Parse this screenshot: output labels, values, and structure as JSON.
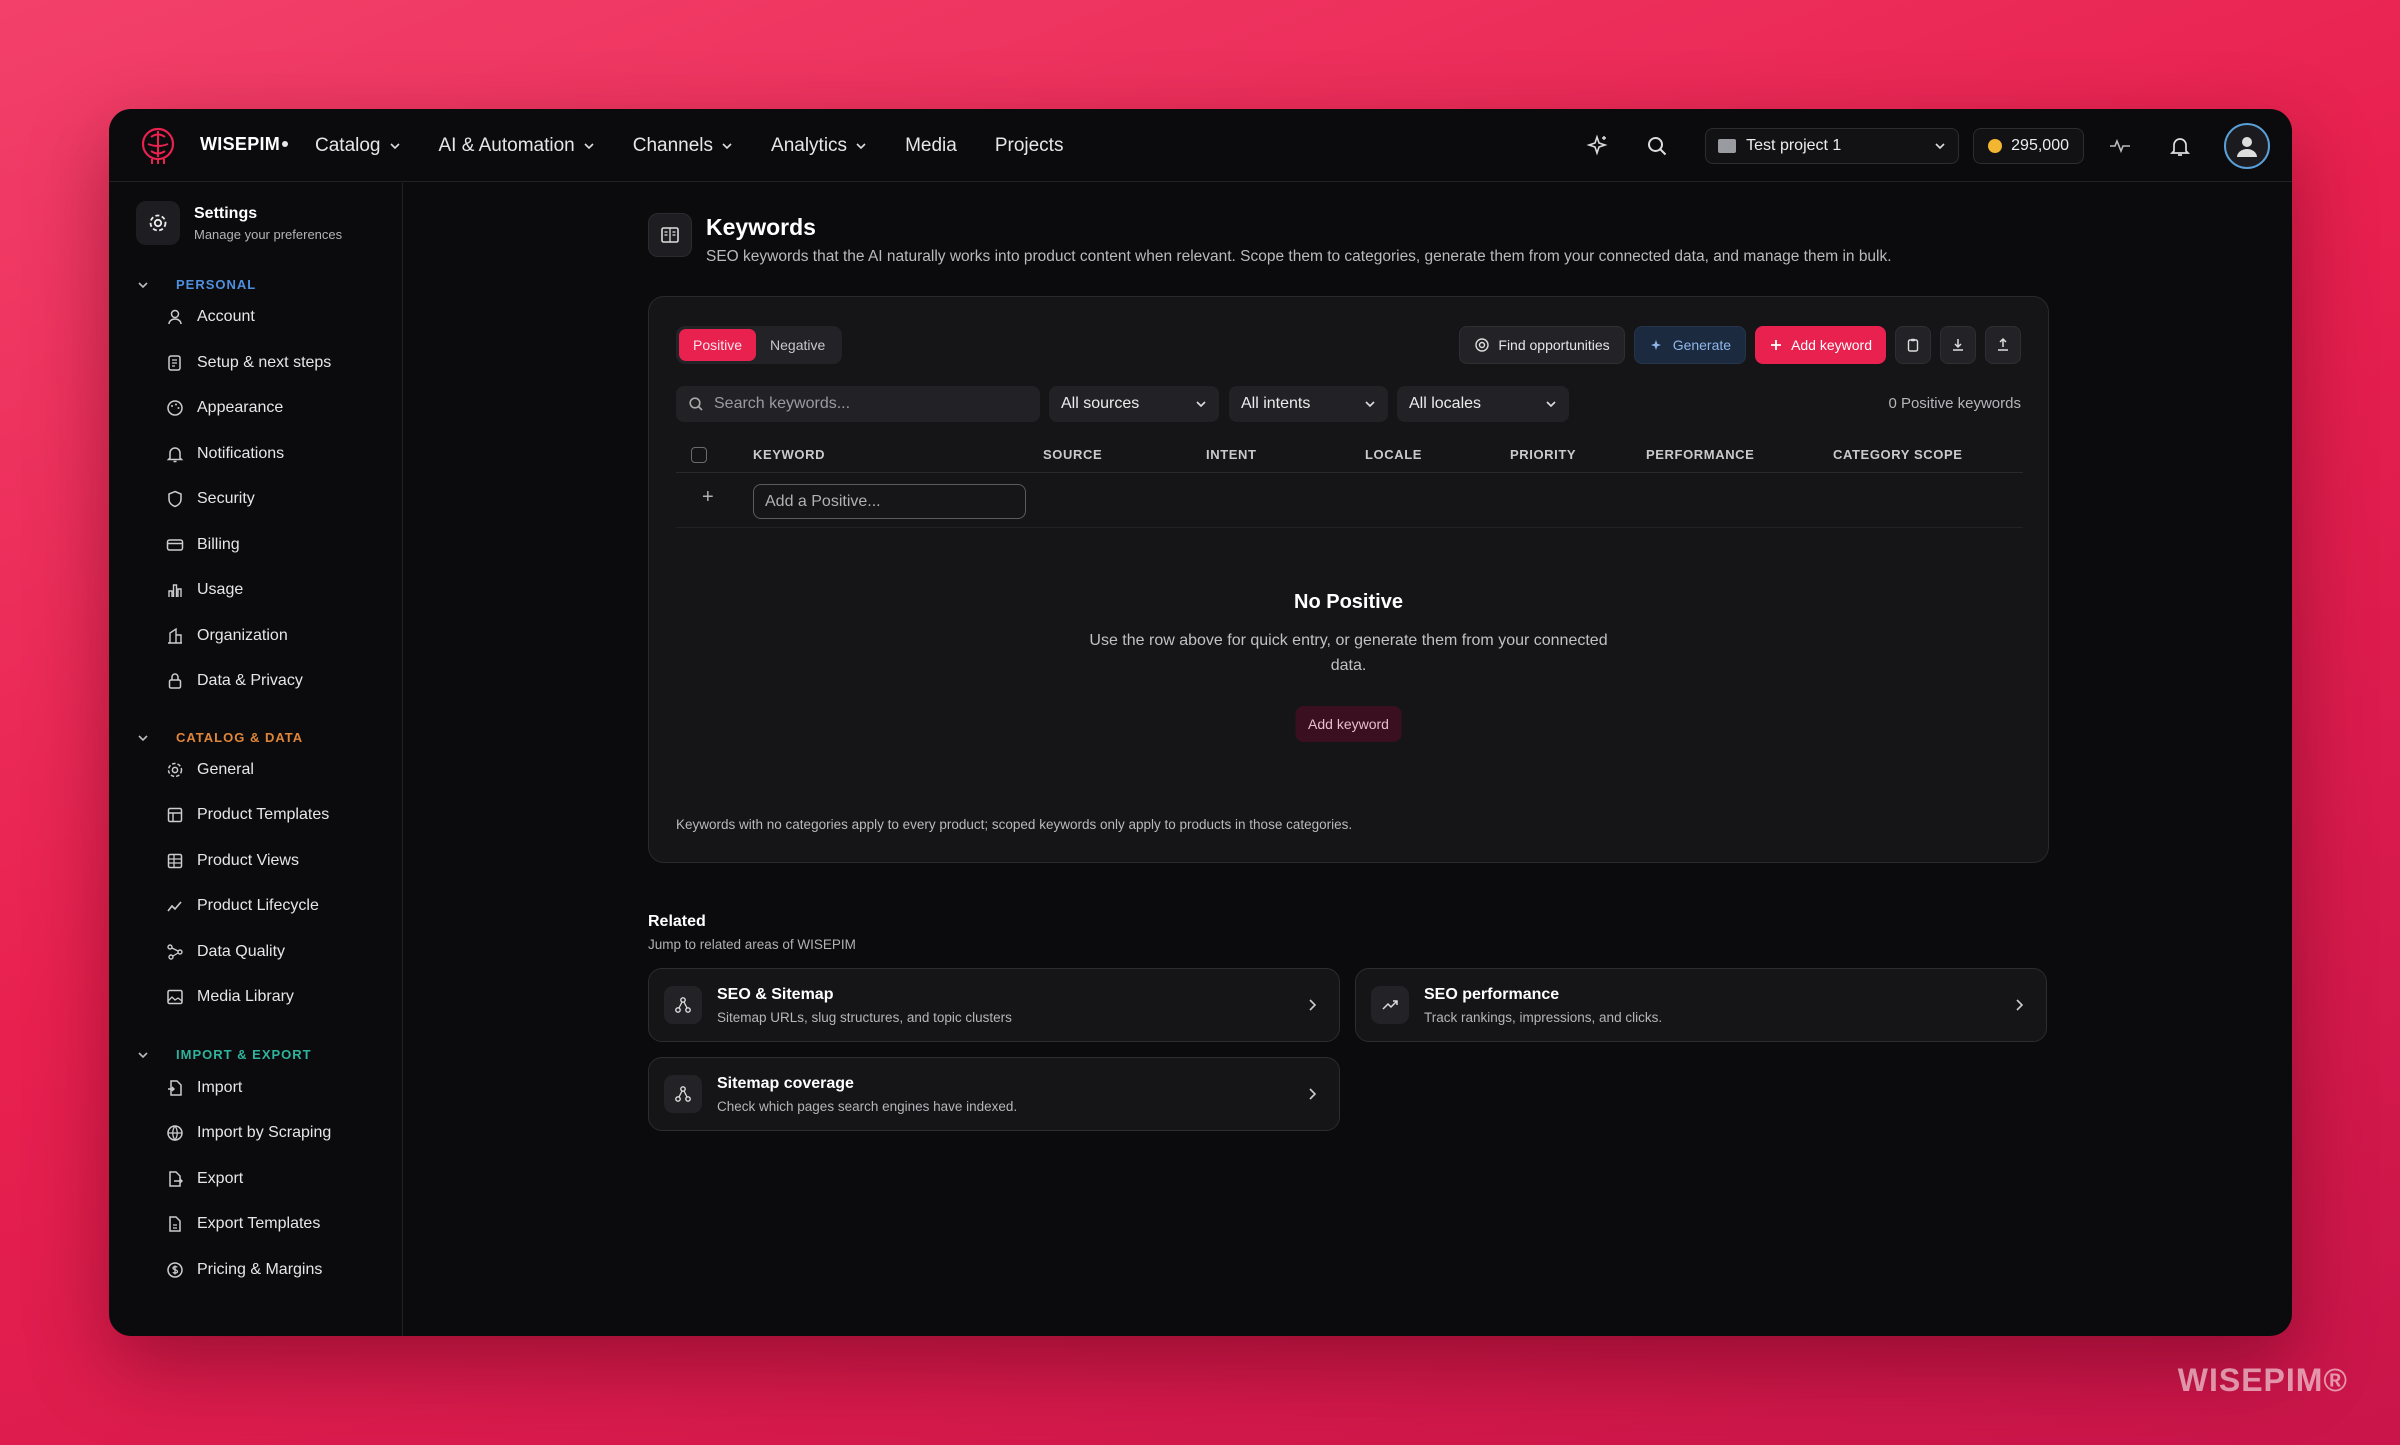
{
  "brand": {
    "name": "WISEPIM"
  },
  "nav": {
    "items": [
      {
        "label": "Catalog",
        "dropdown": true
      },
      {
        "label": "AI & Automation",
        "dropdown": true
      },
      {
        "label": "Channels",
        "dropdown": true
      },
      {
        "label": "Analytics",
        "dropdown": true
      },
      {
        "label": "Media",
        "dropdown": false
      },
      {
        "label": "Projects",
        "dropdown": false
      }
    ]
  },
  "topbar": {
    "project": "Test project 1",
    "credits": "295,000"
  },
  "sidebar": {
    "title": "Settings",
    "subtitle": "Manage your preferences",
    "sections": [
      {
        "label": "PERSONAL",
        "color": "#4f8fe0",
        "items": [
          "Account",
          "Setup & next steps",
          "Appearance",
          "Notifications",
          "Security",
          "Billing",
          "Usage",
          "Organization",
          "Data & Privacy"
        ]
      },
      {
        "label": "CATALOG & DATA",
        "color": "#e0863a",
        "items": [
          "General",
          "Product Templates",
          "Product Views",
          "Product Lifecycle",
          "Data Quality",
          "Media Library"
        ]
      },
      {
        "label": "IMPORT & EXPORT",
        "color": "#2fb39c",
        "items": [
          "Import",
          "Import by Scraping",
          "Export",
          "Export Templates",
          "Pricing & Margins"
        ]
      }
    ]
  },
  "page": {
    "title": "Keywords",
    "description": "SEO keywords that the AI naturally works into product content when relevant. Scope them to categories, generate them from your connected data, and manage them in bulk."
  },
  "keywords": {
    "tabs": [
      {
        "label": "Positive",
        "active": true
      },
      {
        "label": "Negative",
        "active": false
      }
    ],
    "actions": {
      "find": "Find opportunities",
      "generate": "Generate",
      "add": "Add keyword"
    },
    "search_placeholder": "Search keywords...",
    "filters": [
      "All sources",
      "All intents",
      "All locales"
    ],
    "count_label": "0 Positive keywords",
    "columns": [
      "KEYWORD",
      "SOURCE",
      "INTENT",
      "LOCALE",
      "PRIORITY",
      "PERFORMANCE",
      "CATEGORY SCOPE"
    ],
    "add_row_placeholder": "Add a Positive...",
    "empty": {
      "title": "No Positive",
      "description": "Use the row above for quick entry, or generate them from your connected data.",
      "button": "Add keyword"
    },
    "footnote": "Keywords with no categories apply to every product; scoped keywords only apply to products in those categories."
  },
  "related": {
    "title": "Related",
    "subtitle": "Jump to related areas of WISEPIM",
    "cards": [
      {
        "title": "SEO & Sitemap",
        "subtitle": "Sitemap URLs, slug structures, and topic clusters",
        "icon": "sitemap-icon"
      },
      {
        "title": "SEO performance",
        "subtitle": "Track rankings, impressions, and clicks.",
        "icon": "trending-up-icon"
      },
      {
        "title": "Sitemap coverage",
        "subtitle": "Check which pages search engines have indexed.",
        "icon": "sitemap-icon"
      }
    ]
  },
  "watermark": "WISEPIM®",
  "colors": {
    "accent": "#e8214f",
    "background": "#0b0b0d",
    "card": "#151518"
  }
}
